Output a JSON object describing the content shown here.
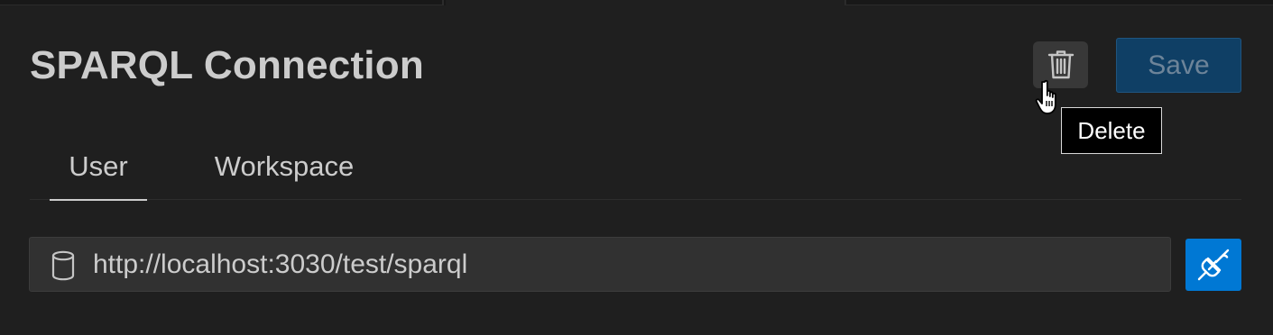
{
  "header": {
    "title": "SPARQL Connection",
    "save_label": "Save"
  },
  "icons": {
    "delete": "trash-icon",
    "database": "database-icon",
    "connect": "plug-icon",
    "cursor": "hand-pointer-cursor"
  },
  "tooltip": {
    "text": "Delete"
  },
  "tabs": [
    {
      "label": "User",
      "active": true
    },
    {
      "label": "Workspace",
      "active": false
    }
  ],
  "connection": {
    "url": "http://localhost:3030/test/sparql"
  },
  "colors": {
    "background": "#1f1f1f",
    "accent": "#0078d4",
    "save_disabled_bg": "#0f3f65"
  }
}
